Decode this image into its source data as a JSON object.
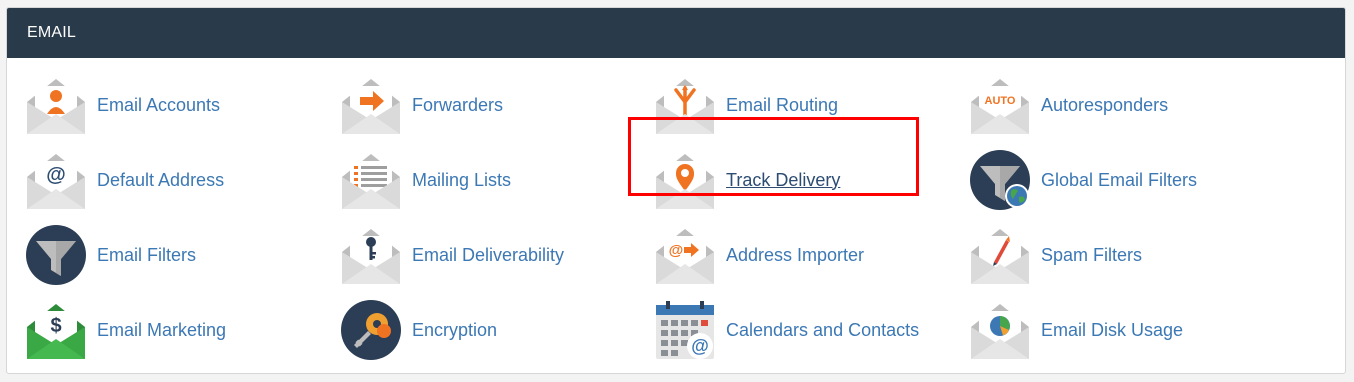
{
  "header": {
    "title": "EMAIL"
  },
  "colors": {
    "header_bg": "#293a4a",
    "link": "#3c78b4",
    "accent_orange": "#f07322",
    "highlight_border": "#ff0000"
  },
  "items": [
    {
      "label": "Email Accounts",
      "icon": "email-accounts-icon"
    },
    {
      "label": "Forwarders",
      "icon": "forwarders-icon"
    },
    {
      "label": "Email Routing",
      "icon": "email-routing-icon",
      "highlighted": true
    },
    {
      "label": "Autoresponders",
      "icon": "autoresponders-icon",
      "icon_text": "AUTO"
    },
    {
      "label": "Default Address",
      "icon": "default-address-icon",
      "icon_text": "@"
    },
    {
      "label": "Mailing Lists",
      "icon": "mailing-lists-icon"
    },
    {
      "label": "Track Delivery",
      "icon": "track-delivery-icon",
      "underlined": true
    },
    {
      "label": "Global Email Filters",
      "icon": "global-email-filters-icon"
    },
    {
      "label": "Email Filters",
      "icon": "email-filters-icon"
    },
    {
      "label": "Email Deliverability",
      "icon": "email-deliverability-icon"
    },
    {
      "label": "Address Importer",
      "icon": "address-importer-icon",
      "icon_text": "@"
    },
    {
      "label": "Spam Filters",
      "icon": "spam-filters-icon"
    },
    {
      "label": "Email Marketing",
      "icon": "email-marketing-icon",
      "icon_text": "$"
    },
    {
      "label": "Encryption",
      "icon": "encryption-icon"
    },
    {
      "label": "Calendars and Contacts",
      "icon": "calendars-and-contacts-icon",
      "icon_text": "@"
    },
    {
      "label": "Email Disk Usage",
      "icon": "email-disk-usage-icon"
    }
  ]
}
